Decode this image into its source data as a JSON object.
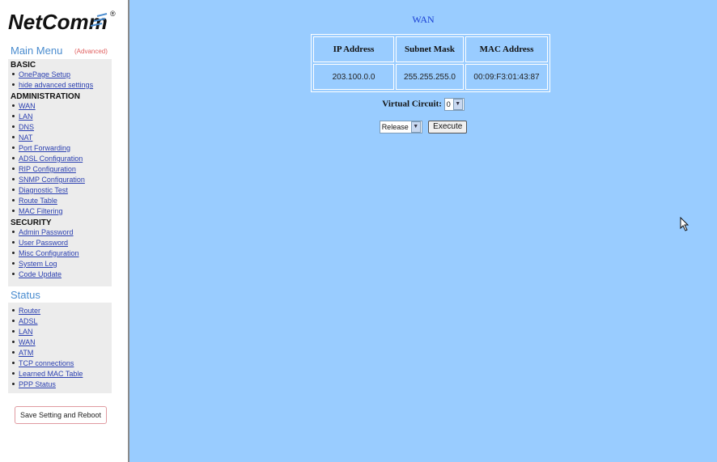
{
  "brand": {
    "logo_text": "NetComm",
    "registered": "®"
  },
  "sidebar": {
    "main_menu_title": "Main Menu",
    "advanced_tag": "(Advanced)",
    "sections": [
      {
        "heading": "BASIC",
        "items": [
          "OnePage Setup",
          "hide advanced settings"
        ]
      },
      {
        "heading": "ADMINISTRATION",
        "items": [
          "WAN",
          "LAN",
          "DNS",
          "NAT",
          "Port Forwarding",
          "ADSL Configuration",
          "RIP Configuration",
          "SNMP Configuration",
          "Diagnostic Test",
          "Route Table",
          "MAC Filtering"
        ]
      },
      {
        "heading": "SECURITY",
        "items": [
          "Admin Password",
          "User Password",
          "Misc Configuration",
          "System Log",
          "Code Update"
        ]
      }
    ],
    "status_title": "Status",
    "status_items": [
      "Router",
      "ADSL",
      "LAN",
      "WAN",
      "ATM",
      "TCP connections",
      "Learned MAC Table",
      "PPP Status"
    ],
    "save_button": "Save Setting and Reboot"
  },
  "main": {
    "title": "WAN",
    "table": {
      "headers": [
        "IP Address",
        "Subnet Mask",
        "MAC Address"
      ],
      "rows": [
        [
          "203.100.0.0",
          "255.255.255.0",
          "00:09:F3:01:43:87"
        ]
      ]
    },
    "virtual_circuit_label": "Virtual Circuit:",
    "virtual_circuit_value": "0",
    "action_select_value": "Release",
    "execute_button": "Execute"
  },
  "colors": {
    "content_bg": "#99ccff",
    "link": "#2a3fb0",
    "title": "#1a3fd4",
    "menu_title": "#4a8ccf"
  }
}
